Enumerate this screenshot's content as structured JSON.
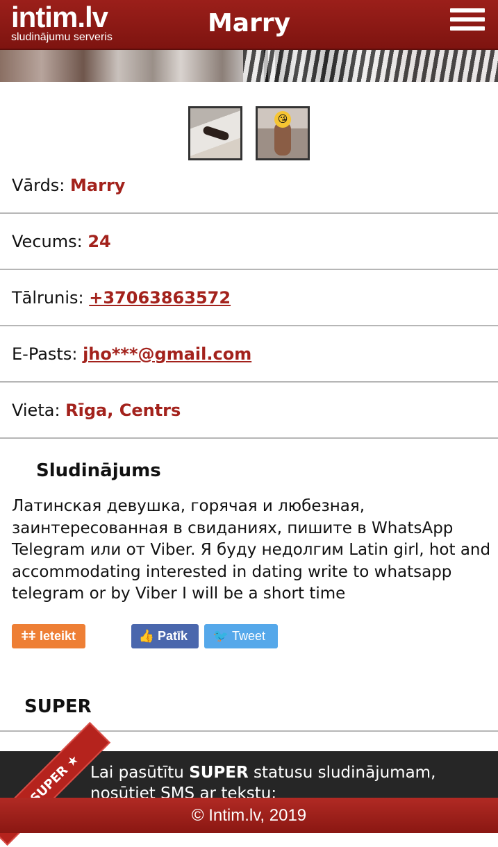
{
  "header": {
    "logo_name": "intim.lv",
    "logo_subtitle": "sludinājumu serveris",
    "title": "Marry",
    "menu_icon": "hamburger-menu-icon"
  },
  "photos": [
    {
      "alt": "photo-1"
    },
    {
      "alt": "photo-2"
    }
  ],
  "profile": {
    "name_label": "Vārds:",
    "name_value": "Marry",
    "age_label": "Vecums:",
    "age_value": "24",
    "phone_label": "Tālrunis:",
    "phone_value": "+37063863572",
    "email_label": "E-Pasts:",
    "email_value": "jho***@gmail.com",
    "location_label": "Vieta:",
    "location_value": "Rīga, Centrs"
  },
  "ad": {
    "title": "Sludinājums",
    "text": "Латинская девушка, горячая и любезная, заинтересованная в свиданиях, пишите в WhatsApp Telegram или от Viber. Я буду недолгим Latin girl, hot and accommodating interested in dating write to whatsapp telegram or by Viber I will be a short time"
  },
  "actions": {
    "report_label": "Ieteikt",
    "like_label": "Patīk",
    "tweet_label": "Tweet"
  },
  "super": {
    "title": "SUPER",
    "ribbon_label": "★ SUPER ★",
    "text_prefix": "Lai pasūtītu ",
    "text_bold": "SUPER",
    "text_suffix": " statusu sludinājumam, nosūtiet SMS ar tekstu:"
  },
  "footer": {
    "copyright": "© Intim.lv, 2019"
  },
  "colors": {
    "brand_red": "#9b1f1a",
    "value_red": "#a3221c",
    "report_orange": "#ee7f35",
    "facebook_blue": "#4a67ad",
    "twitter_blue": "#55a8ea"
  }
}
